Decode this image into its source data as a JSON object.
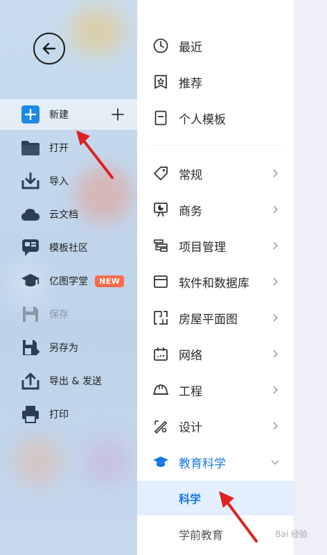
{
  "left_menu": {
    "items": [
      {
        "label": "新建"
      },
      {
        "label": "打开"
      },
      {
        "label": "导入"
      },
      {
        "label": "云文档"
      },
      {
        "label": "模板社区"
      },
      {
        "label": "亿图学堂",
        "badge": "NEW"
      },
      {
        "label": "保存"
      },
      {
        "label": "另存为"
      },
      {
        "label": "导出 & 发送"
      },
      {
        "label": "打印"
      }
    ]
  },
  "templates": {
    "top": [
      {
        "label": "最近",
        "icon": "clock-icon"
      },
      {
        "label": "推荐",
        "icon": "star-bookmark-icon"
      },
      {
        "label": "个人模板",
        "icon": "document-icon"
      }
    ],
    "categories": [
      {
        "label": "常规",
        "icon": "tag-icon"
      },
      {
        "label": "商务",
        "icon": "presentation-icon"
      },
      {
        "label": "项目管理",
        "icon": "gantt-icon"
      },
      {
        "label": "软件和数据库",
        "icon": "window-icon"
      },
      {
        "label": "房屋平面图",
        "icon": "floorplan-icon"
      },
      {
        "label": "网络",
        "icon": "network-icon"
      },
      {
        "label": "工程",
        "icon": "helmet-icon"
      },
      {
        "label": "设计",
        "icon": "design-tools-icon"
      },
      {
        "label": "教育科学",
        "icon": "graduation-cap-icon",
        "expanded": true
      }
    ],
    "sub_items": [
      {
        "label": "科学",
        "selected": true
      },
      {
        "label": "学前教育"
      }
    ]
  },
  "watermark": "Bai 经验",
  "colors": {
    "accent": "#1677e8",
    "badge": "#ff6b4a",
    "arrow": "#e02020"
  }
}
